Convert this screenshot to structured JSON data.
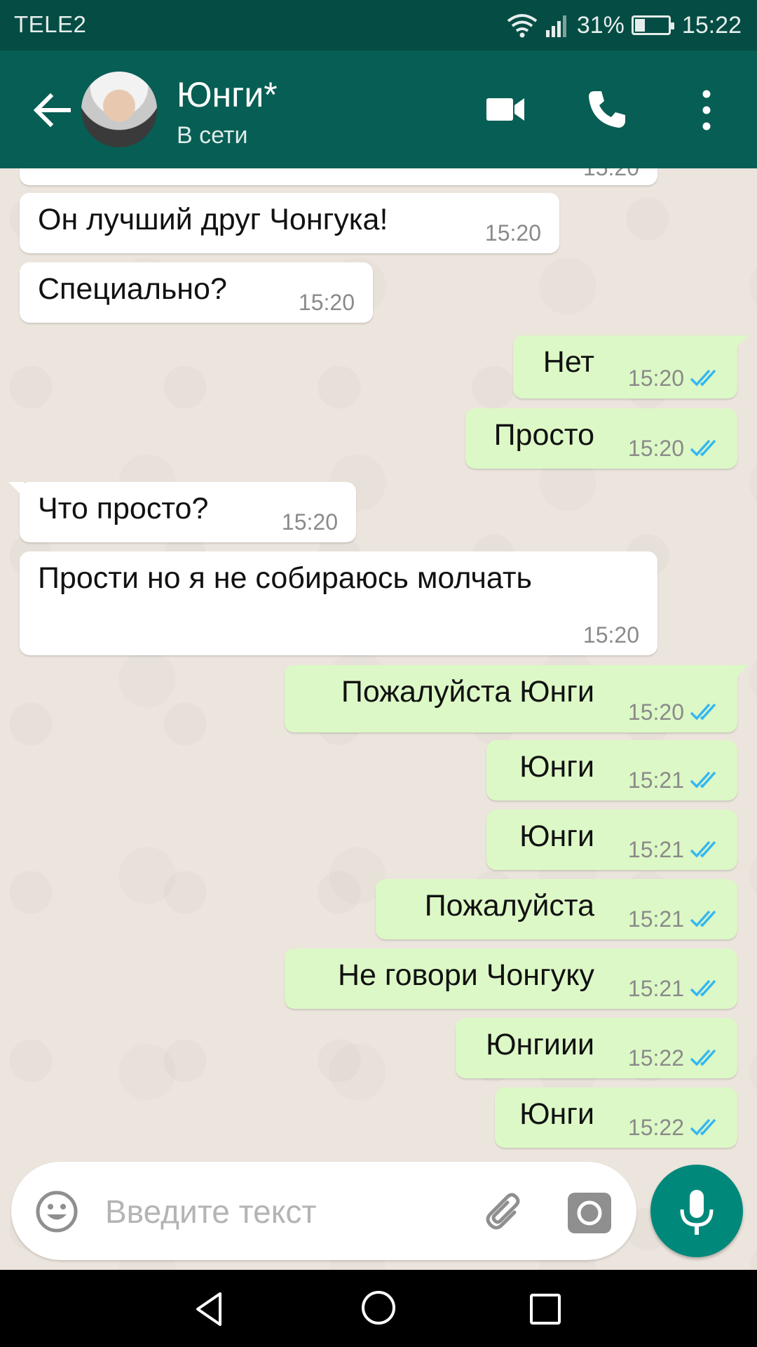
{
  "status_bar": {
    "carrier": "TELE2",
    "battery_percent": "31%",
    "battery_level": 0.31,
    "time": "15:22"
  },
  "header": {
    "contact_name": "Юнги*",
    "contact_status": "В сети"
  },
  "partial_top_time": "15:20",
  "messages": [
    {
      "dir": "in",
      "text": "Он лучший друг Чонгука!",
      "time": "15:20"
    },
    {
      "dir": "in",
      "text": "Специально?",
      "time": "15:20"
    },
    {
      "dir": "out",
      "text": "Нет",
      "time": "15:20",
      "status": "read"
    },
    {
      "dir": "out",
      "text": "Просто",
      "time": "15:20",
      "status": "read"
    },
    {
      "dir": "in",
      "text": "Что просто?",
      "time": "15:20"
    },
    {
      "dir": "in",
      "text": "Прости но я не собираюсь молчать",
      "time": "15:20"
    },
    {
      "dir": "out",
      "text": "Пожалуйста Юнги",
      "time": "15:20",
      "status": "read"
    },
    {
      "dir": "out",
      "text": "Юнги",
      "time": "15:21",
      "status": "read"
    },
    {
      "dir": "out",
      "text": "Юнги",
      "time": "15:21",
      "status": "read"
    },
    {
      "dir": "out",
      "text": "Пожалуйста",
      "time": "15:21",
      "status": "read"
    },
    {
      "dir": "out",
      "text": "Не говори Чонгуку",
      "time": "15:21",
      "status": "read"
    },
    {
      "dir": "out",
      "text": "Юнгиии",
      "time": "15:22",
      "status": "read"
    },
    {
      "dir": "out",
      "text": "Юнги",
      "time": "15:22",
      "status": "read"
    }
  ],
  "composer": {
    "placeholder": "Введите текст"
  },
  "icons": {
    "back": "arrow-left-icon",
    "video": "video-camera-icon",
    "call": "phone-icon",
    "menu": "more-vert-icon",
    "emoji": "emoji-icon",
    "attach": "paperclip-icon",
    "camera": "camera-icon",
    "mic": "microphone-icon",
    "ticks": "double-check-icon"
  },
  "colors": {
    "header": "#075E54",
    "status_bar": "#054D44",
    "outgoing_bubble": "#DCF8C6",
    "incoming_bubble": "#FFFFFF",
    "read_ticks": "#34B7F1",
    "mic_button": "#00897B",
    "chat_bg": "#ECE5DD"
  }
}
